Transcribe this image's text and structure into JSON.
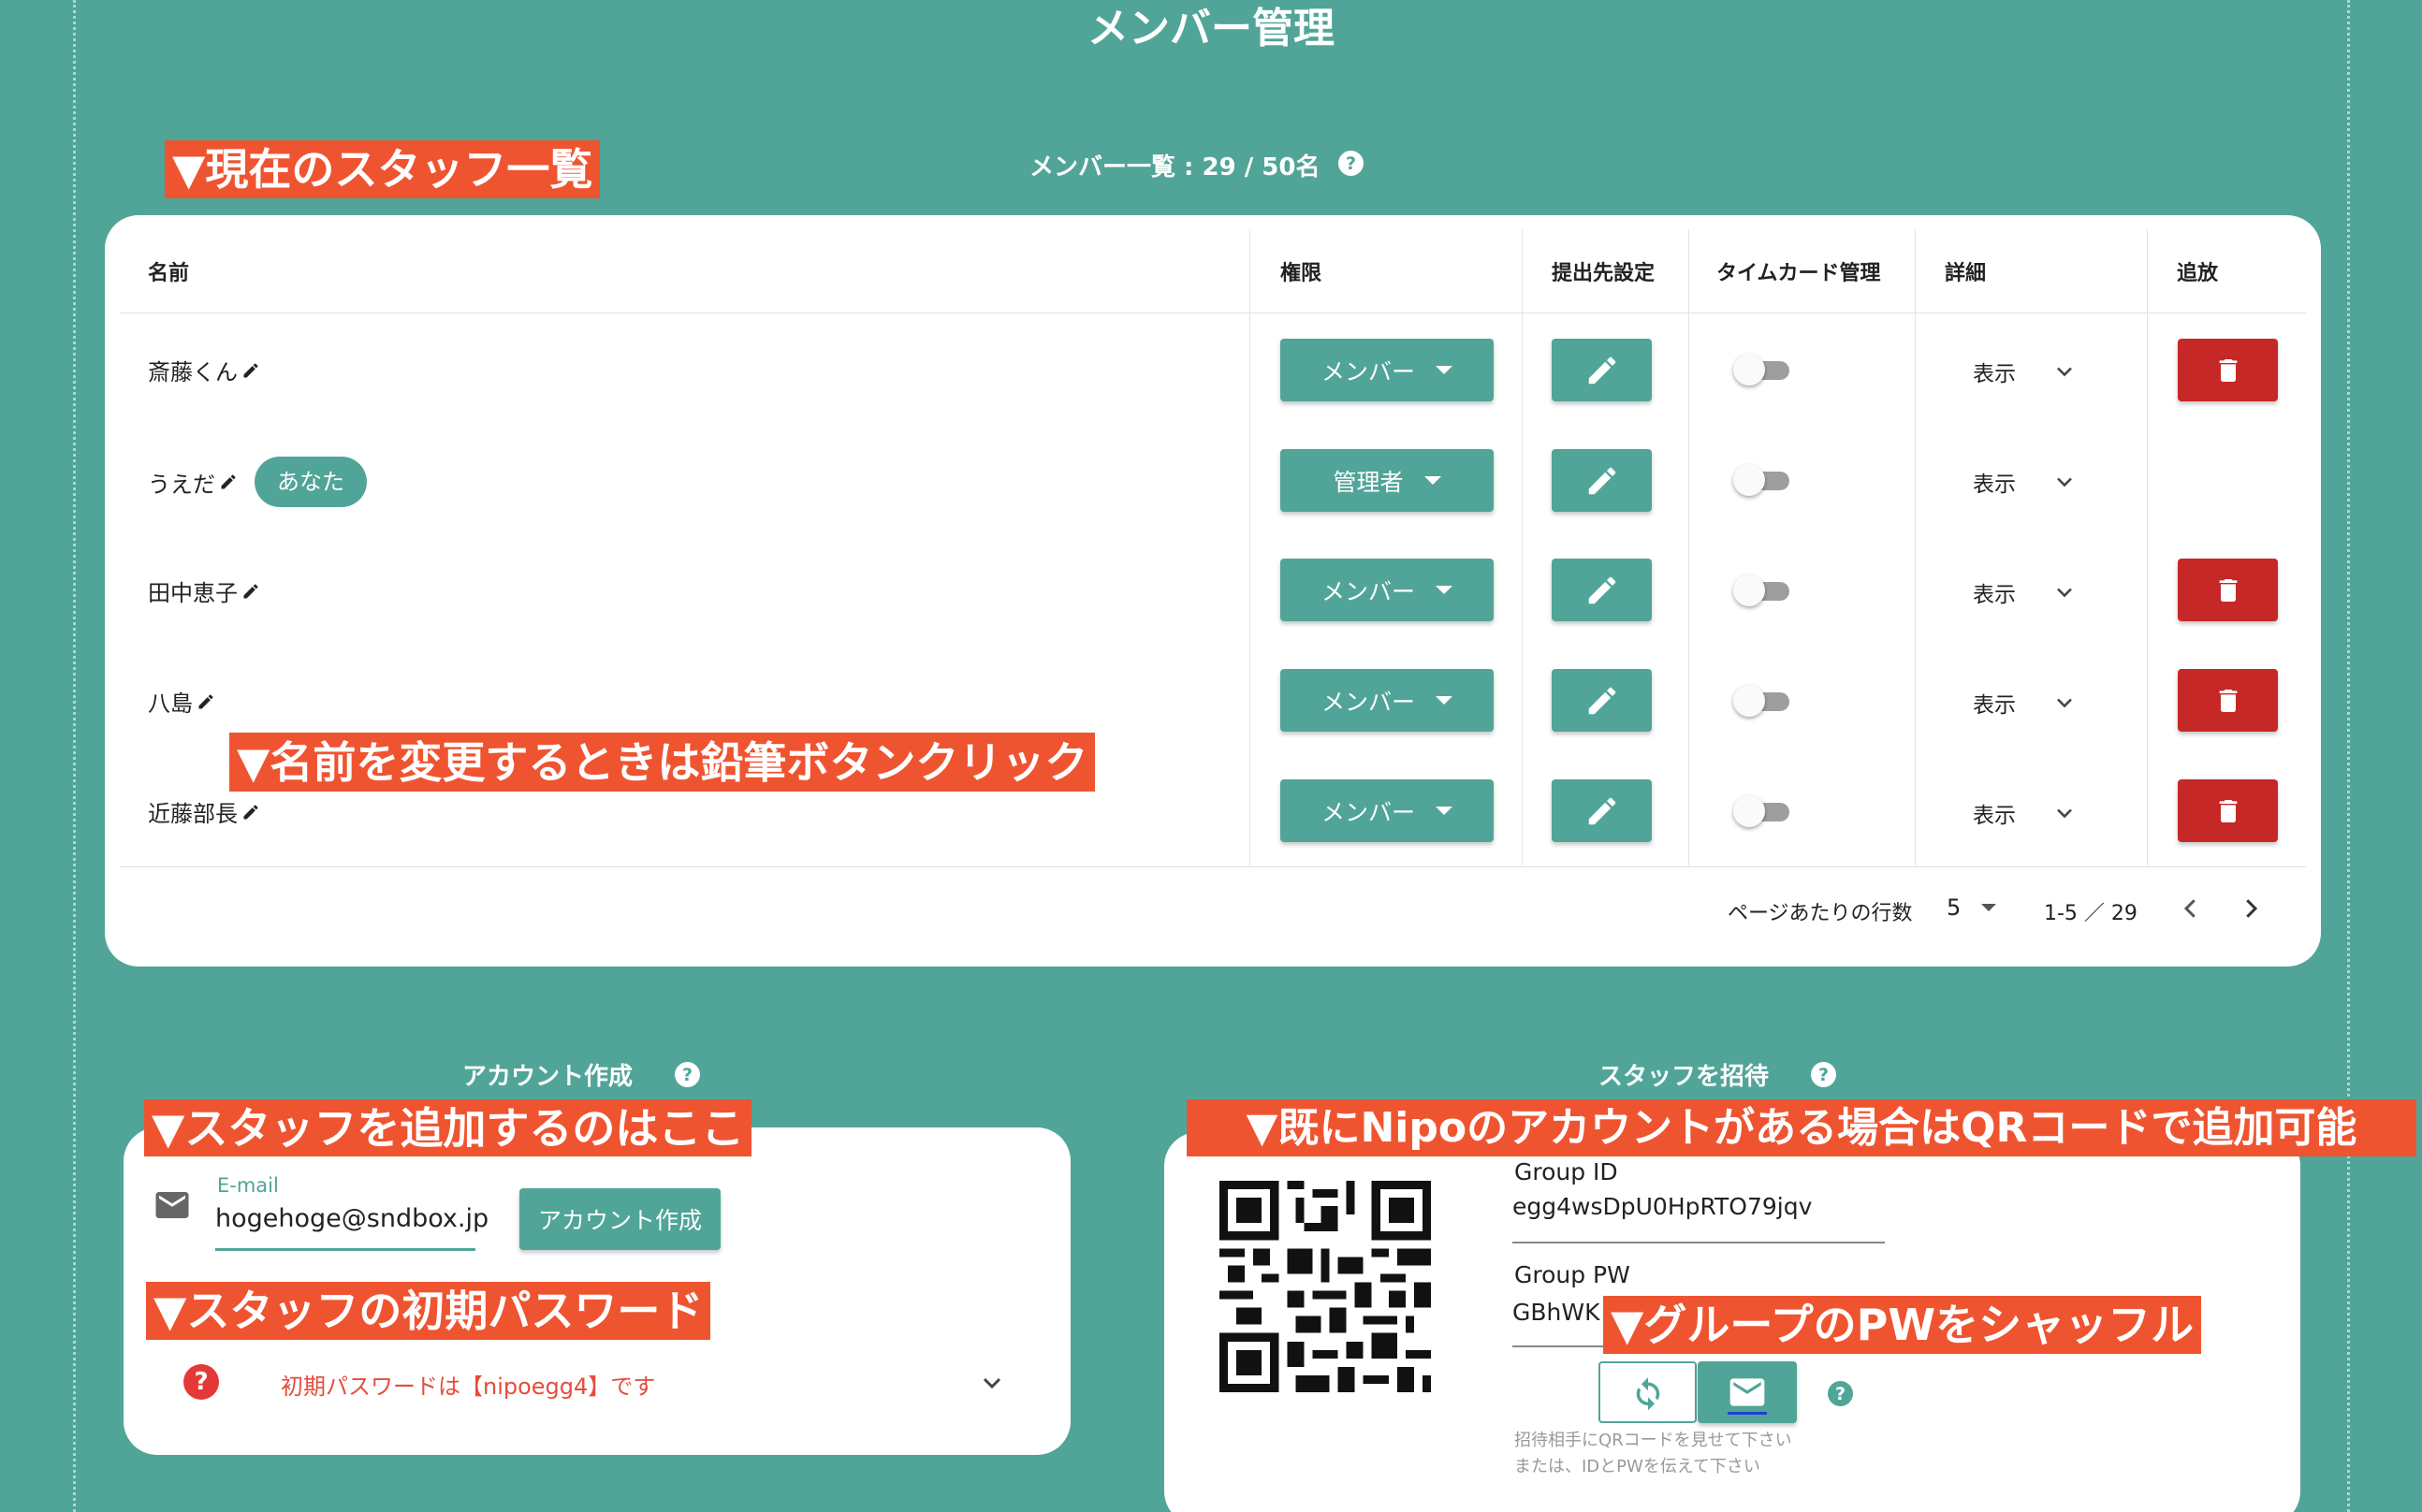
{
  "page": {
    "title": "メンバー管理"
  },
  "members_section": {
    "header": "メンバー一覧 : 29 / 50名",
    "columns": {
      "name": "名前",
      "role": "権限",
      "destination": "提出先設定",
      "timecard": "タイムカード管理",
      "details": "詳細",
      "remove": "追放"
    },
    "rows": [
      {
        "name": "斎藤くん",
        "you_badge": "",
        "role": "メンバー",
        "timecard_on": false,
        "details": "表示",
        "removable": true
      },
      {
        "name": "うえだ",
        "you_badge": "あなた",
        "role": "管理者",
        "timecard_on": false,
        "details": "表示",
        "removable": false
      },
      {
        "name": "田中恵子",
        "you_badge": "",
        "role": "メンバー",
        "timecard_on": false,
        "details": "表示",
        "removable": true
      },
      {
        "name": "八島",
        "you_badge": "",
        "role": "メンバー",
        "timecard_on": false,
        "details": "表示",
        "removable": true
      },
      {
        "name": "近藤部長",
        "you_badge": "",
        "role": "メンバー",
        "timecard_on": false,
        "details": "表示",
        "removable": true
      }
    ],
    "pagination": {
      "rows_per_page_label": "ページあたりの行数",
      "rows_per_page": "5",
      "range": "1-5 ／ 29"
    }
  },
  "account_section": {
    "header": "アカウント作成",
    "email_label": "E-mail",
    "email_value": "hogehoge@sndbox.jp",
    "create_button": "アカウント作成",
    "initial_password_text": "初期パスワードは【nipoegg4】です"
  },
  "invite_section": {
    "header": "スタッフを招待",
    "group_id_label": "Group ID",
    "group_id_value": "egg4wsDpU0HpRTO79jqv",
    "group_pw_label": "Group PW",
    "group_pw_value": "GBhWK",
    "note_line1": "招待相手にQRコードを見せて下さい",
    "note_line2": "または、IDとPWを伝えて下さい"
  },
  "annotations": {
    "current_staff": "▼現在のスタッフ一覧",
    "rename_hint": "▼名前を変更するときは鉛筆ボタンクリック",
    "add_staff": "▼スタッフを追加するのはここ",
    "initial_password": "▼スタッフの初期パスワード",
    "qr_add": "▼既にNipoのアカウントがある場合はQRコードで追加可能",
    "shuffle_pw": "▼グループのPWをシャッフル"
  },
  "colors": {
    "background": "#50a598",
    "primary": "#50a598",
    "danger": "#c62828",
    "annotation": "#ef5431",
    "error_text": "#e74c3c"
  },
  "icons": [
    "pencil-icon",
    "chevron-down-icon",
    "trash-icon",
    "mail-icon",
    "help-icon",
    "refresh-icon",
    "qr-code",
    "chevron-left-icon",
    "chevron-right-icon",
    "dropdown-caret-icon"
  ]
}
